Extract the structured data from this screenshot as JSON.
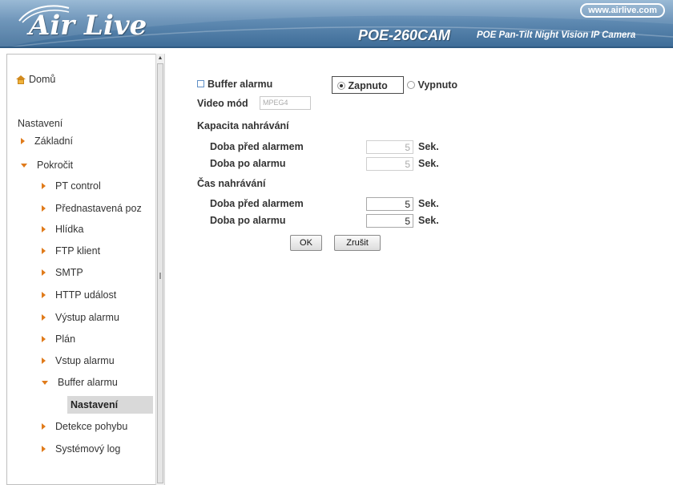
{
  "header": {
    "brand": "Air Live",
    "url": "www.airlive.com",
    "model": "POE-260CAM",
    "tagline": "POE Pan-Tilt Night Vision IP Camera"
  },
  "sidebar": {
    "home": "Domů",
    "section": "Nastavení",
    "items": [
      {
        "label": "Základní",
        "state": "collapsed"
      },
      {
        "label": "Pokročit",
        "state": "expanded"
      },
      {
        "label": "PT control",
        "state": "collapsed"
      },
      {
        "label": "Přednastavená poz",
        "state": "collapsed"
      },
      {
        "label": "Hlídka",
        "state": "collapsed"
      },
      {
        "label": "FTP klient",
        "state": "collapsed"
      },
      {
        "label": "SMTP",
        "state": "collapsed"
      },
      {
        "label": "HTTP událost",
        "state": "collapsed"
      },
      {
        "label": "Výstup alarmu",
        "state": "collapsed"
      },
      {
        "label": "Plán",
        "state": "collapsed"
      },
      {
        "label": "Vstup alarmu",
        "state": "collapsed"
      },
      {
        "label": "Buffer alarmu",
        "state": "expanded"
      },
      {
        "label": "Detekce pohybu",
        "state": "collapsed"
      },
      {
        "label": "Systémový log",
        "state": "collapsed"
      }
    ],
    "active": "Nastavení"
  },
  "form": {
    "buffer_label": "Buffer alarmu",
    "on_label": "Zapnuto",
    "off_label": "Vypnuto",
    "selected": "Zapnuto",
    "video_mode_label": "Video mód",
    "video_mode_value": "MPEG4",
    "capacity_title": "Kapacita nahrávání",
    "time_title": "Čas nahrávání",
    "pre_alarm_label": "Doba před alarmem",
    "post_alarm_label": "Doba po alarmu",
    "unit": "Sek.",
    "capacity_pre": "5",
    "capacity_post": "5",
    "time_pre": "5",
    "time_post": "5",
    "ok_label": "OK",
    "cancel_label": "Zrušit"
  },
  "colors": {
    "header_top": "#8fb2d1",
    "header_bottom": "#3f6d98",
    "arrow": "#e07b1b",
    "active_bg": "#d9d9d9"
  }
}
